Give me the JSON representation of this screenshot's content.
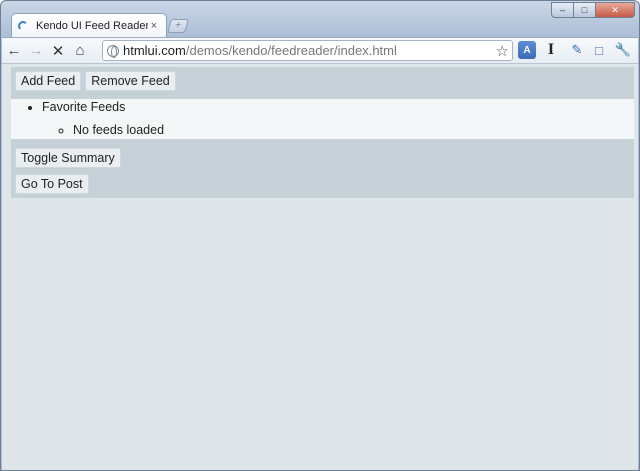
{
  "browser": {
    "tab_title": "Kendo UI Feed Reader",
    "tab_close": "×",
    "new_tab": "+",
    "url_host": "htmlui.com",
    "url_path": "/demos/kendo/feedreader/index.html",
    "window_controls": {
      "minimize": "–",
      "maximize": "□",
      "close": "✕"
    }
  },
  "toolbar": {
    "buttons": [
      "Add Feed",
      "Remove Feed"
    ]
  },
  "feeds": {
    "group_label": "Favorite Feeds",
    "empty_message": "No feeds loaded"
  },
  "actions": {
    "toggle_summary": "Toggle Summary",
    "go_to_post": "Go To Post"
  },
  "colors": {
    "page_background": "#dfe6ea",
    "bar_background": "#c5d0d7",
    "list_background": "#f4f7f8",
    "button_background": "#e9eef1"
  }
}
